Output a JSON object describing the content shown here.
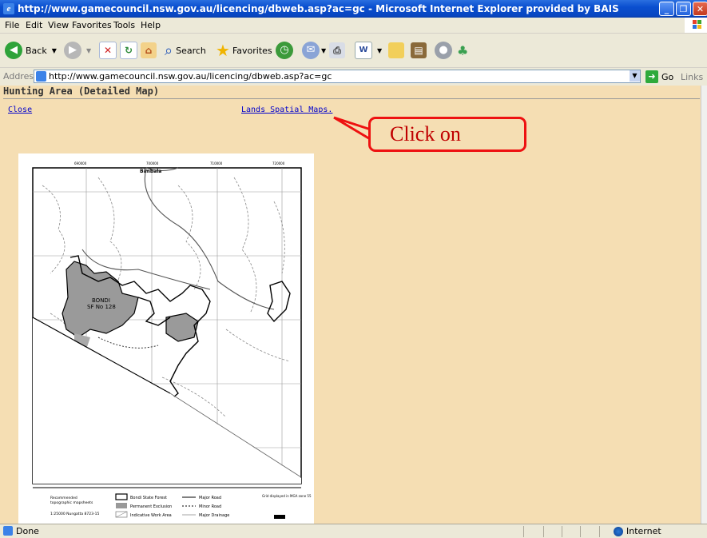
{
  "window": {
    "title": "http://www.gamecouncil.nsw.gov.au/licencing/dbweb.asp?ac=gc - Microsoft Internet Explorer provided by BAIS"
  },
  "menu": [
    "File",
    "Edit",
    "View",
    "Favorites",
    "Tools",
    "Help"
  ],
  "toolbar": {
    "back_label": "Back",
    "search_label": "Search",
    "favorites_label": "Favorites"
  },
  "address": {
    "label": "Address",
    "url": "http://www.gamecouncil.nsw.gov.au/licencing/dbweb.asp?ac=gc",
    "go_label": "Go",
    "links_label": "Links"
  },
  "page": {
    "heading": "Hunting Area (Detailed Map)",
    "close_link": "Close",
    "lands_link": "Lands Spatial Maps."
  },
  "callout": {
    "text": "Click on",
    "color": "#ee1111"
  },
  "map": {
    "place_name": "Bimbala",
    "forest_label_1": "BONDI",
    "forest_label_2": "SF No 128",
    "legend": {
      "recommended": "Recommended",
      "topo": "topographic mapsheets",
      "mapsheet": "1:25000 Nungatta 8723-15",
      "bondi_state_forest": "Bondi State Forest",
      "permanent_exclusion": "Permanent Exclusion",
      "indicative_work_area": "Indicative Work Area",
      "major_road": "Major Road",
      "minor_road": "Minor Road",
      "major_drainage": "Major Drainage",
      "grid_note": "Grid displayed in MGA zone 55"
    },
    "eastings": [
      "690000",
      "700000",
      "710000",
      "720000"
    ]
  },
  "status": {
    "text": "Done",
    "zone": "Internet"
  },
  "colors": {
    "page_background": "#f5deb3",
    "link": "#0000cc",
    "titlebar": "#0a4fcf"
  }
}
